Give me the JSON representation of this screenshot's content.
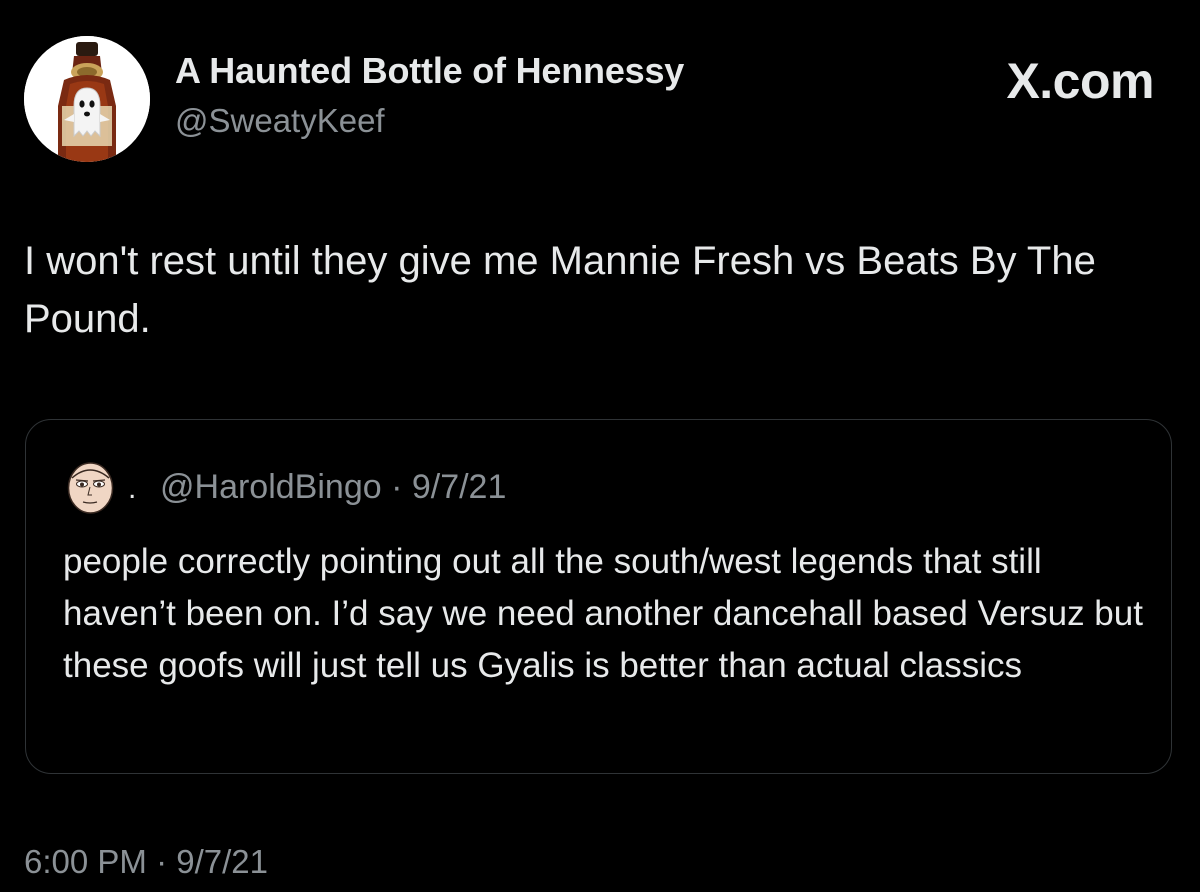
{
  "tweet": {
    "author_name": "A Haunted Bottle of Hennessy",
    "author_handle": "@SweatyKeef",
    "brand": "X.com",
    "text": "I won't rest until they give me Mannie Fresh vs Beats By The Pound.",
    "timestamp": "6:00 PM · 9/7/21"
  },
  "quote": {
    "separator": ".",
    "handle_date": "@HaroldBingo · 9/7/21",
    "text": "people correctly pointing out all the south/west legends that still haven’t been on. I’d say we need another dancehall based Versuz but these goofs will just tell us Gyalis is better than actual classics"
  },
  "colors": {
    "background": "#000000",
    "primary_text": "#e7e9ea",
    "secondary_text": "#8b9196",
    "border": "#2f3336"
  },
  "icons": {
    "author_avatar": "hennessy-bottle-ghost-avatar",
    "quote_avatar": "cartoon-face-avatar"
  }
}
